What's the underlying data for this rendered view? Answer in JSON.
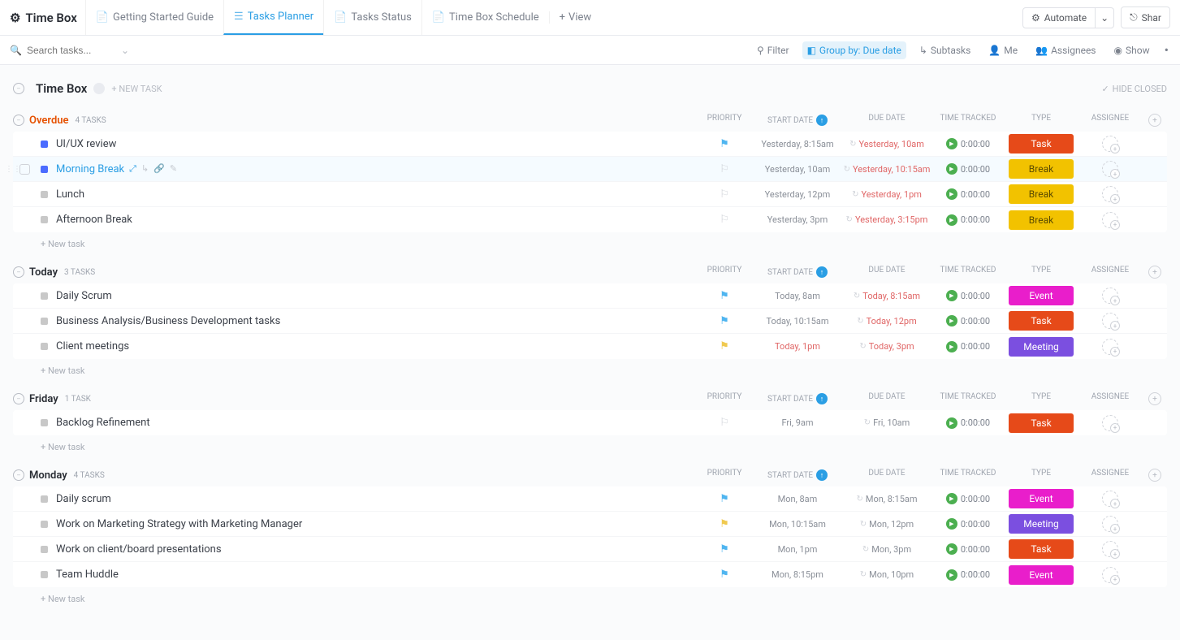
{
  "topbar": {
    "title": "Time Box",
    "tabs": [
      {
        "label": "Getting Started Guide",
        "icon": "doc"
      },
      {
        "label": "Tasks Planner",
        "icon": "list",
        "active": true
      },
      {
        "label": "Tasks Status",
        "icon": "doc"
      },
      {
        "label": "Time Box Schedule",
        "icon": "doc"
      }
    ],
    "add_view": "View",
    "automate": "Automate",
    "share": "Shar"
  },
  "toolbar": {
    "search_placeholder": "Search tasks...",
    "filter": "Filter",
    "group_by": "Group by: Due date",
    "subtasks": "Subtasks",
    "me": "Me",
    "assignees": "Assignees",
    "show": "Show"
  },
  "list": {
    "name": "Time Box",
    "new_task": "+ NEW TASK",
    "hide_closed": "HIDE CLOSED"
  },
  "columns": {
    "priority": "PRIORITY",
    "start_date": "START DATE",
    "due_date": "DUE DATE",
    "time_tracked": "TIME TRACKED",
    "type": "TYPE",
    "assignee": "ASSIGNEE"
  },
  "new_task_label": "+ New task",
  "groups": [
    {
      "name": "Overdue",
      "count": "4 TASKS",
      "overdue": true,
      "tasks": [
        {
          "status": "#4b6cff",
          "name": "UI/UX review",
          "flag": "blue",
          "start": "Yesterday, 8:15am",
          "due": "Yesterday, 10am",
          "due_red": true,
          "recur": true,
          "track": "0:00:00",
          "type": "Task",
          "type_class": "type-task"
        },
        {
          "status": "#4b6cff",
          "name": "Morning Break",
          "flag": "grey",
          "start": "Yesterday, 10am",
          "due": "Yesterday, 10:15am",
          "due_red": true,
          "recur": true,
          "track": "0:00:00",
          "type": "Break",
          "type_class": "type-break",
          "hover": true,
          "showIcons": true
        },
        {
          "status": "#c8c8c8",
          "name": "Lunch",
          "flag": "grey",
          "start": "Yesterday, 12pm",
          "due": "Yesterday, 1pm",
          "due_red": true,
          "recur": true,
          "track": "0:00:00",
          "type": "Break",
          "type_class": "type-break"
        },
        {
          "status": "#c8c8c8",
          "name": "Afternoon Break",
          "flag": "grey",
          "start": "Yesterday, 3pm",
          "due": "Yesterday, 3:15pm",
          "due_red": true,
          "recur": true,
          "track": "0:00:00",
          "type": "Break",
          "type_class": "type-break"
        }
      ]
    },
    {
      "name": "Today",
      "count": "3 TASKS",
      "tasks": [
        {
          "status": "#c8c8c8",
          "name": "Daily Scrum",
          "flag": "blue",
          "start": "Today, 8am",
          "due": "Today, 8:15am",
          "due_red": true,
          "recur": true,
          "track": "0:00:00",
          "type": "Event",
          "type_class": "type-event"
        },
        {
          "status": "#c8c8c8",
          "name": "Business Analysis/Business Development tasks",
          "flag": "blue",
          "start": "Today, 10:15am",
          "due": "Today, 12pm",
          "due_red": true,
          "recur": true,
          "track": "0:00:00",
          "type": "Task",
          "type_class": "type-task"
        },
        {
          "status": "#c8c8c8",
          "name": "Client meetings",
          "flag": "yellow",
          "start": "Today, 1pm",
          "start_red": true,
          "due": "Today, 3pm",
          "due_red": true,
          "recur": true,
          "track": "0:00:00",
          "type": "Meeting",
          "type_class": "type-meeting"
        }
      ]
    },
    {
      "name": "Friday",
      "count": "1 TASK",
      "tasks": [
        {
          "status": "#c8c8c8",
          "name": "Backlog Refinement",
          "flag": "grey",
          "start": "Fri, 9am",
          "due": "Fri, 10am",
          "recur": true,
          "track": "0:00:00",
          "type": "Task",
          "type_class": "type-task"
        }
      ]
    },
    {
      "name": "Monday",
      "count": "4 TASKS",
      "tasks": [
        {
          "status": "#c8c8c8",
          "name": "Daily scrum",
          "flag": "blue",
          "start": "Mon, 8am",
          "due": "Mon, 8:15am",
          "recur": true,
          "track": "0:00:00",
          "type": "Event",
          "type_class": "type-event"
        },
        {
          "status": "#c8c8c8",
          "name": "Work on Marketing Strategy with Marketing Manager",
          "flag": "yellow",
          "start": "Mon, 10:15am",
          "due": "Mon, 12pm",
          "recur": true,
          "track": "0:00:00",
          "type": "Meeting",
          "type_class": "type-meeting"
        },
        {
          "status": "#c8c8c8",
          "name": "Work on client/board presentations",
          "flag": "blue",
          "start": "Mon, 1pm",
          "due": "Mon, 3pm",
          "recur": true,
          "track": "0:00:00",
          "type": "Task",
          "type_class": "type-task"
        },
        {
          "status": "#c8c8c8",
          "name": "Team Huddle",
          "flag": "blue",
          "start": "Mon, 8:15pm",
          "due": "Mon, 10pm",
          "recur": true,
          "track": "0:00:00",
          "type": "Event",
          "type_class": "type-event"
        }
      ]
    }
  ]
}
